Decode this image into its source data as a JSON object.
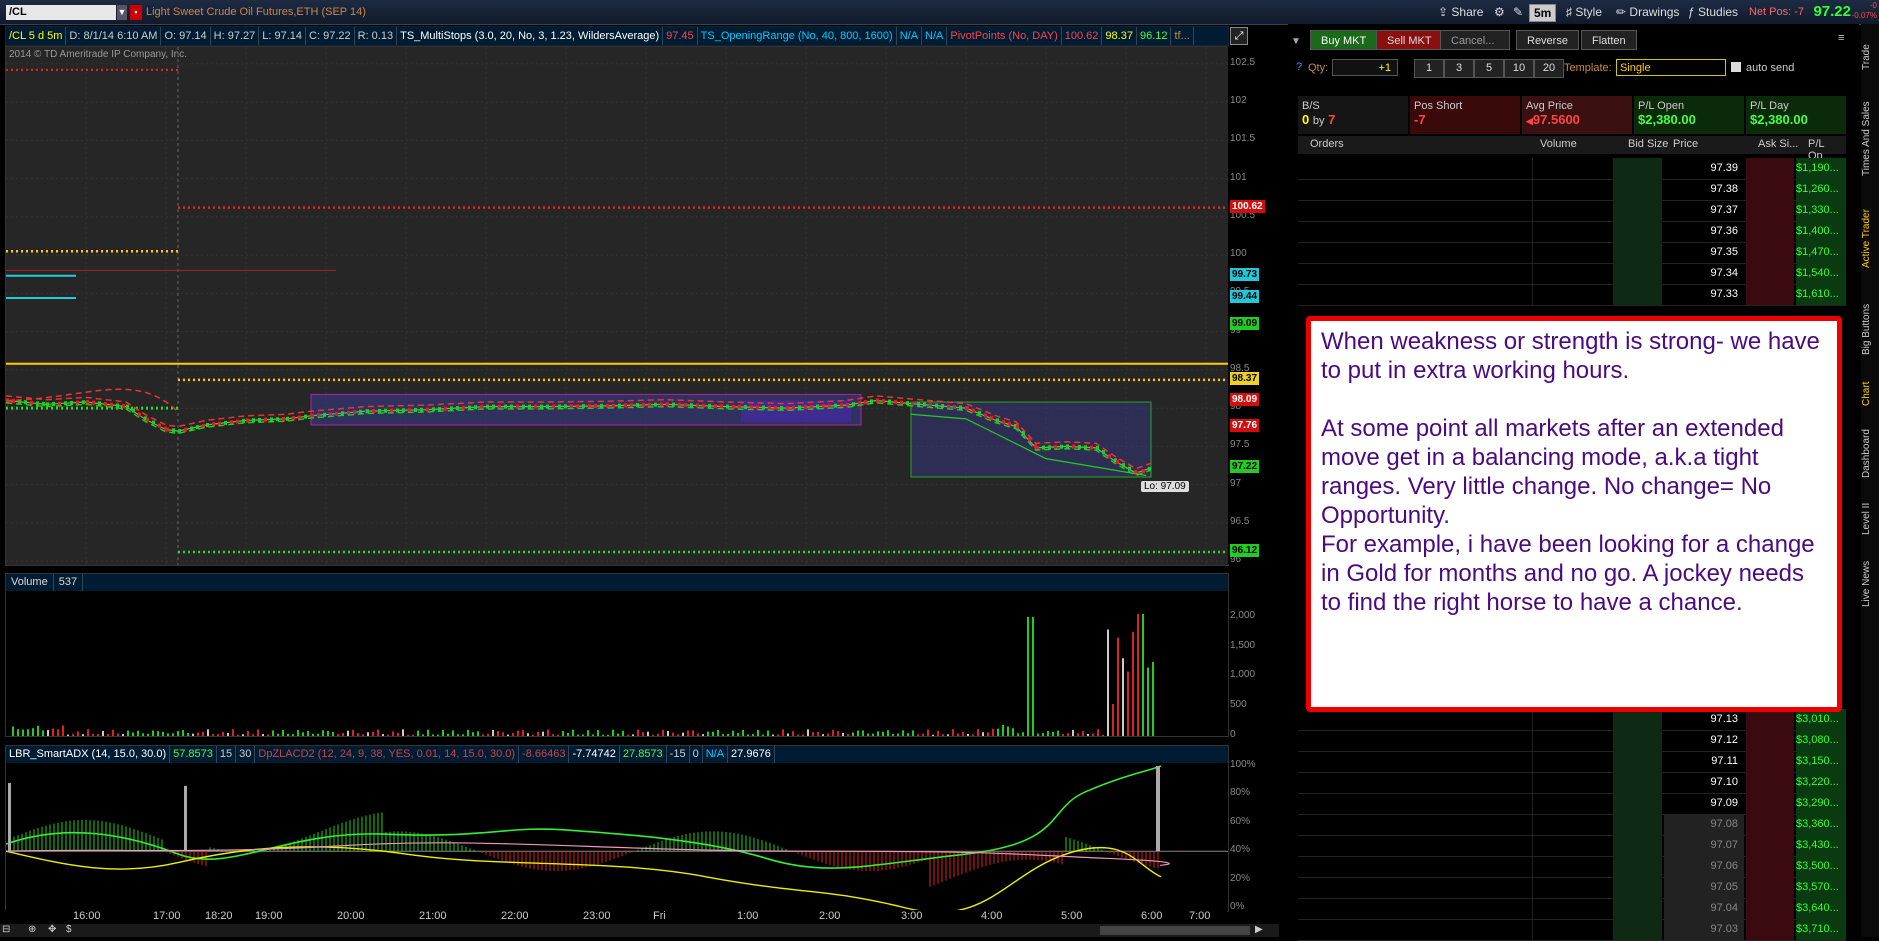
{
  "topbar": {
    "symbol": "/CL",
    "description": "Light Sweet Crude Oil Futures,ETH (SEP 14)",
    "share": "Share",
    "timeframe": "5m",
    "style": "Style",
    "drawings": "Drawings",
    "studies": "Studies",
    "net_pos": "Net Pos: -7",
    "last_price": "97.22",
    "change_top": "-0",
    "change_bottom": "-0.07%"
  },
  "studybar": {
    "items": [
      "/CL 5 d 5m",
      "D: 8/1/14 6:10 AM",
      "O: 97.14",
      "H: 97.27",
      "L: 97.14",
      "C: 97.22",
      "R: 0.13",
      "TS_MultiStops (3.0, 20, No, 3, 1.23, WildersAverage)",
      "97.45",
      "TS_OpeningRange (No, 40, 800, 1600)",
      "N/A",
      "N/A",
      "PivotPoints (No, DAY)",
      "100.62",
      "98.37",
      "96.12",
      "tf..."
    ]
  },
  "pricepane": {
    "copyright": "2014 © TD Ameritrade IP Company, Inc.",
    "low_label": "Lo: 97.09",
    "ticks": [
      "102.5",
      "102",
      "101.5",
      "101",
      "100.5",
      "100",
      "99.5",
      "99",
      "98.5",
      "98",
      "97.5",
      "97",
      "96.5",
      "96"
    ],
    "badges": [
      {
        "text": "100.62",
        "bg": "#d01010",
        "fg": "#fff"
      },
      {
        "text": "99.73",
        "bg": "#20c8d8",
        "fg": "#000"
      },
      {
        "text": "99.44",
        "bg": "#20c8d8",
        "fg": "#000"
      },
      {
        "text": "99.09",
        "bg": "#22cc22",
        "fg": "#000"
      },
      {
        "text": "98.37",
        "bg": "#f0d020",
        "fg": "#000"
      },
      {
        "text": "98.09",
        "bg": "#d01010",
        "fg": "#fff"
      },
      {
        "text": "97.76",
        "bg": "#d01010",
        "fg": "#fff"
      },
      {
        "text": "97.22",
        "bg": "#22cc22",
        "fg": "#000"
      },
      {
        "text": "96.12",
        "bg": "#22cc22",
        "fg": "#000"
      }
    ]
  },
  "volpane": {
    "label": "Volume",
    "value": "537",
    "ticks": [
      "2,000",
      "1,500",
      "1,000",
      "500",
      "0"
    ]
  },
  "adxpane": {
    "items": [
      "LBR_SmartADX (14, 15.0, 30.0)",
      "57.8573",
      "15",
      "30",
      "DpZLACD2 (12, 24, 9, 38, YES, 0.01, 14, 15.0, 30.0)",
      "-8.66463",
      "-7.74742",
      "27.8573",
      "-15",
      "0",
      "N/A",
      "27.9676"
    ],
    "ticks": [
      "100%",
      "80%",
      "60%",
      "40%",
      "20%",
      "0%"
    ]
  },
  "timeaxis": [
    "16:00",
    "17:00",
    "18:20",
    "19:00",
    "20:00",
    "21:00",
    "22:00",
    "23:00",
    "Fri",
    "1:00",
    "2:00",
    "3:00",
    "4:00",
    "5:00",
    "6:00",
    "7:00"
  ],
  "trade": {
    "buy_mkt": "Buy MKT",
    "sell_mkt": "Sell MKT",
    "cancel": "Cancel...",
    "reverse": "Reverse",
    "flatten": "Flatten",
    "qty_label": "Qty:",
    "qty_value": "+1",
    "qty_buttons": [
      "1",
      "3",
      "5",
      "10",
      "20"
    ],
    "template_label": "Template:",
    "template_value": "Single",
    "auto_send": "auto send",
    "position": {
      "bs_label": "B/S",
      "bs_value0": "0",
      "bs_by": "by",
      "bs_value7": "7",
      "pos_label": "Pos Short",
      "pos_value": "-7",
      "avg_label": "Avg Price",
      "avg_value": "97.5600",
      "plopen_label": "P/L Open",
      "plopen_value": "$2,380.00",
      "plday_label": "P/L Day",
      "plday_value": "$2,380.00"
    },
    "ladder_headers": [
      "Orders",
      "Volume",
      "Bid Size",
      "Price",
      "Ask Si...",
      "P/L Op..."
    ],
    "ladder_top": [
      {
        "price": "97.39",
        "pl": "$1,190..."
      },
      {
        "price": "97.38",
        "pl": "$1,260..."
      },
      {
        "price": "97.37",
        "pl": "$1,330..."
      },
      {
        "price": "97.36",
        "pl": "$1,400..."
      },
      {
        "price": "97.35",
        "pl": "$1,470..."
      },
      {
        "price": "97.34",
        "pl": "$1,540..."
      },
      {
        "price": "97.33",
        "pl": "$1,610..."
      }
    ],
    "ladder_bottom": [
      {
        "price": "97.13",
        "pl": "$3,010...",
        "dim": false
      },
      {
        "price": "97.12",
        "pl": "$3,080...",
        "dim": false
      },
      {
        "price": "97.11",
        "pl": "$3,150...",
        "dim": false
      },
      {
        "price": "97.10",
        "pl": "$3,220...",
        "dim": false
      },
      {
        "price": "97.09",
        "pl": "$3,290...",
        "dim": false
      },
      {
        "price": "97.08",
        "pl": "$3,360...",
        "dim": true
      },
      {
        "price": "97.07",
        "pl": "$3,430...",
        "dim": true
      },
      {
        "price": "97.06",
        "pl": "$3,500...",
        "dim": true
      },
      {
        "price": "97.05",
        "pl": "$3,570...",
        "dim": true
      },
      {
        "price": "97.04",
        "pl": "$3,640...",
        "dim": true
      },
      {
        "price": "97.03",
        "pl": "$3,710...",
        "dim": true
      }
    ]
  },
  "vtabs": [
    "Trade",
    "Times And Sales",
    "Active Trader",
    "Big Buttons",
    "Chart",
    "Dashboard",
    "Level II",
    "Live News"
  ],
  "note": {
    "p1": "When weakness or strength is strong- we have to put in extra working hours.",
    "p2": "At some point all markets after an extended move get in a balancing mode, a.k.a tight ranges. Very little change. No change= No Opportunity.",
    "p3": "For example, i have been looking for a change in Gold for months and no go. A jockey needs to find the right horse to have a chance."
  },
  "colors": {
    "buy": "#1a6a1a",
    "sell": "#8a1010",
    "note_text": "#4a0a80",
    "note_border": "#e00000"
  }
}
